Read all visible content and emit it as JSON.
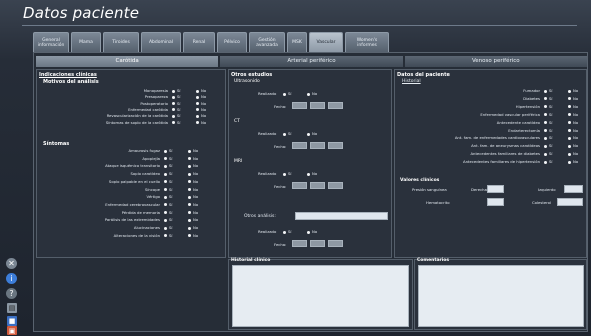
{
  "title": "Datos paciente",
  "tabs": [
    "General información",
    "Mama",
    "Tiroides",
    "Abdominal",
    "Renal",
    "Pélvico",
    "Gestión avanzada",
    "MSK",
    "Vascular",
    "Women's informes"
  ],
  "subtabs": [
    "Carótida",
    "Arterial periférico",
    "Venoso periférico"
  ],
  "col1": {
    "heading": "Indicaciones clínicas",
    "subheading": "Motivos del análisis",
    "reasons": [
      "Monoparesia",
      "Presopareza",
      "Postoperatorio",
      "Enfermedad carótida",
      "Revascularización de la carótida",
      "Síntomas de soplo de la carótida"
    ],
    "symptoms_heading": "Síntomas",
    "symptoms": [
      "Amaurosis fugaz",
      "Apoplejía",
      "Ataque isquémico transitorio",
      "Soplo carotídeo",
      "Soplo palpable en el cuello",
      "Síncope",
      "Vértigo",
      "Enfermedad cerebrovascular",
      "Pérdida de memoria",
      "Parálisis de las extremidades",
      "Alucinaciones",
      "Alteraciones de la visión"
    ]
  },
  "col2": {
    "heading": "Otros estudios",
    "sections": [
      {
        "title": "Ultrasonido"
      },
      {
        "title": "CT"
      },
      {
        "title": "MRI"
      }
    ],
    "other_label": "Otros análisis:",
    "realizado": "Realizado",
    "fecha": "Fecha:"
  },
  "col3": {
    "heading": "Datos del paciente",
    "link": "Historial",
    "items": [
      "Fumador",
      "Diabetes",
      "Hipertensión",
      "Enfermedad vascular periférica",
      "Antecedente carotídeo",
      "Endarterectomía",
      "Ant. fam. de enfermedades cardiovasculares",
      "Ant. fam. de aneurysmas carotídeos",
      "Antecedentes familiares de diabetes",
      "Antecedentes familiares de hipertensión"
    ],
    "vitals_heading": "Valores clínicos",
    "vitals": {
      "presion": "Presión sanguínea",
      "derecha": "Derecha",
      "izquierda": "Izquierdo",
      "hematocrito": "Hematocrito",
      "colesterol": "Colesterol"
    }
  },
  "si": "Sí",
  "no": "No",
  "bottom": {
    "historial": "Historial clínico",
    "comentarios": "Comentarios"
  }
}
